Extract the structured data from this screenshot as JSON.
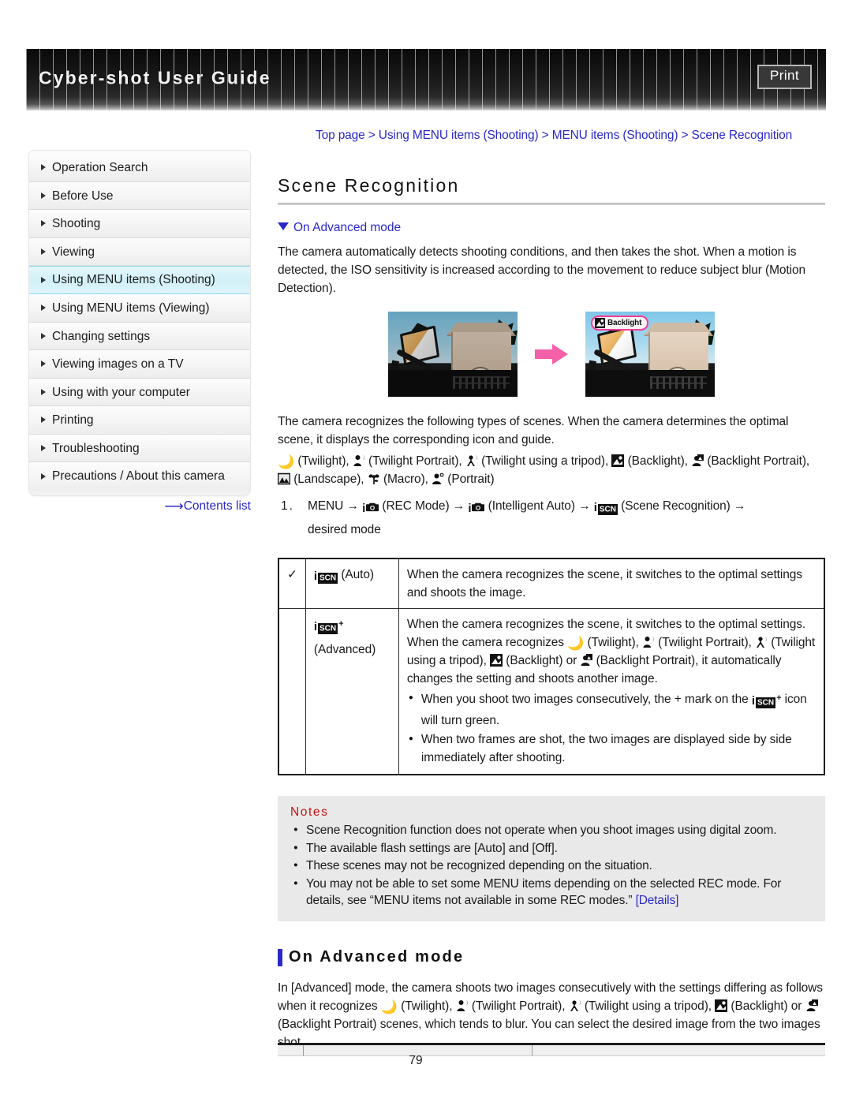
{
  "header": {
    "title": "Cyber-shot User Guide",
    "print_label": "Print"
  },
  "breadcrumb": {
    "text": "Top page > Using MENU items (Shooting) > MENU items (Shooting) > Scene Recognition"
  },
  "sidebar": {
    "items": [
      {
        "label": "Operation Search",
        "active": false
      },
      {
        "label": "Before Use",
        "active": false
      },
      {
        "label": "Shooting",
        "active": false
      },
      {
        "label": "Viewing",
        "active": false
      },
      {
        "label": "Using MENU items (Shooting)",
        "active": true
      },
      {
        "label": "Using MENU items (Viewing)",
        "active": false
      },
      {
        "label": "Changing settings",
        "active": false
      },
      {
        "label": "Viewing images on a TV",
        "active": false
      },
      {
        "label": "Using with your computer",
        "active": false
      },
      {
        "label": "Printing",
        "active": false
      },
      {
        "label": "Troubleshooting",
        "active": false
      },
      {
        "label": "Precautions / About this camera",
        "active": false
      }
    ],
    "contents_link": "Contents list",
    "highlight_color": "#d2f0f8",
    "link_color": "#2b28c8"
  },
  "main": {
    "page_title": "Scene Recognition",
    "jump_link": "On Advanced mode",
    "intro_paragraph": "The camera automatically detects shooting conditions, and then takes the shot. When a motion is detected, the ISO sensitivity is increased according to the movement to reduce subject blur (Motion Detection).",
    "figure": {
      "badge_label": "Backlight",
      "badge_border_color": "#f13d9a",
      "arrow_color": "#f560a8"
    },
    "recognize_paragraph": "The camera recognizes the following types of scenes. When the camera determines the optimal scene, it displays the corresponding icon and guide.",
    "scene_list": {
      "twilight": "(Twilight),",
      "twilight_portrait": "(Twilight Portrait),",
      "twilight_tripod": "(Twilight using a tripod),",
      "backlight": "(Backlight),",
      "backlight_portrait": "(Backlight",
      "backlight_portrait_cont": "Portrait),",
      "landscape": "(Landscape),",
      "macro": "(Macro),",
      "portrait": "(Portrait)"
    },
    "step": {
      "number": "1.",
      "menu": "MENU",
      "rec_mode": "(REC Mode)",
      "intelligent_auto": "(Intelligent Auto)",
      "scene_recognition": "(Scene Recognition)",
      "desired_mode": "desired mode",
      "arrow": "→"
    }
  },
  "mode_table": {
    "rows": [
      {
        "checked": true,
        "check_glyph": "✓",
        "mode_label": "(Auto)",
        "mode_icon": "iscn-icon",
        "description": "When the camera recognizes the scene, it switches to the optimal settings and shoots the image.",
        "bullets": []
      },
      {
        "checked": false,
        "check_glyph": "",
        "mode_label": "(Advanced)",
        "mode_icon": "iscn-plus-icon",
        "description_part1": "When the camera recognizes the scene, it switches to the optimal settings. When the camera recognizes",
        "twilight": "(Twilight),",
        "twilight_portrait": "(Twilight Portrait),",
        "twilight_tripod": "(Twilight",
        "using_tripod": "using a tripod),",
        "backlight": "(Backlight) or",
        "backlight_portrait": "(Backlight Portrait), it automatically",
        "description_part2": "changes the setting and shoots another image.",
        "bullets": [
          {
            "before": "When you shoot two images consecutively, the + mark on the",
            "after": "icon will turn green."
          },
          {
            "before": "When two frames are shot, the two images are displayed side by side immediately after shooting.",
            "after": ""
          }
        ]
      }
    ]
  },
  "notes": {
    "title": "Notes",
    "items": [
      "Scene Recognition function does not operate when you shoot images using digital zoom.",
      "The available flash settings are [Auto] and [Off].",
      "These scenes may not be recognized depending on the situation."
    ],
    "last_item_text": "You may not be able to set some MENU items depending on the selected REC mode. For details, see “MENU items not available in some REC modes.”",
    "last_item_link": "[Details]",
    "background": "#e9e9e9",
    "title_color": "#cc1111"
  },
  "advanced_section": {
    "heading": "On Advanced mode",
    "part1": "In [Advanced] mode, the camera shoots two images consecutively with the settings differing as follows when it recognizes",
    "twilight": "(Twilight),",
    "twilight_portrait": "(Twilight Portrait),",
    "twilight_tripod": "(Twilight using a tripod),",
    "backlight": "(Backlight) or",
    "backlight_portrait": "(Backlight Portrait) scenes, which tends to blur. You can select the desired image from the two images shot.",
    "accent_color": "#2b28c8"
  },
  "footer": {
    "page_number": "79"
  }
}
